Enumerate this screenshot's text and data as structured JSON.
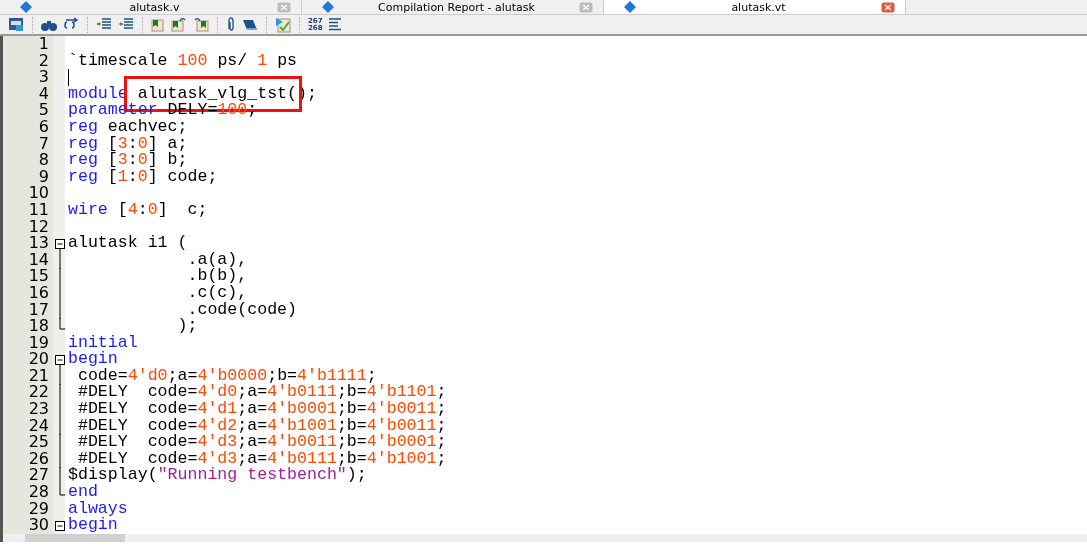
{
  "tabs": [
    {
      "label": "alutask.v",
      "selected": false
    },
    {
      "label": "Compilation Report - alutask",
      "selected": false
    },
    {
      "label": "alutask.vt",
      "selected": true
    }
  ],
  "toolbar": {
    "line_number_icon": [
      "267",
      "268"
    ]
  },
  "lines": [
    {
      "number": "1"
    },
    {
      "number": "2",
      "tokens": [
        {
          "kind": "plain",
          "text": "`timescale "
        },
        {
          "kind": "num",
          "text": "100"
        },
        {
          "kind": "plain",
          "text": " ps/ "
        },
        {
          "kind": "num",
          "text": "1"
        },
        {
          "kind": "plain",
          "text": " ps"
        }
      ]
    },
    {
      "number": "3",
      "cursor": true
    },
    {
      "number": "4",
      "tokens": [
        {
          "kind": "kw",
          "text": "module"
        },
        {
          "kind": "plain",
          "text": " alutask_vlg_tst(",
          "boxed": true
        },
        {
          "kind": "plain",
          "text": ");"
        }
      ]
    },
    {
      "number": "5",
      "tokens": [
        {
          "kind": "kw",
          "text": "parameter"
        },
        {
          "kind": "plain",
          "text": " DELY="
        },
        {
          "kind": "num",
          "text": "100"
        },
        {
          "kind": "plain",
          "text": ";"
        }
      ]
    },
    {
      "number": "6",
      "tokens": [
        {
          "kind": "kw",
          "text": "reg"
        },
        {
          "kind": "plain",
          "text": " eachvec;"
        }
      ]
    },
    {
      "number": "7",
      "tokens": [
        {
          "kind": "kw",
          "text": "reg"
        },
        {
          "kind": "plain",
          "text": " ["
        },
        {
          "kind": "num",
          "text": "3"
        },
        {
          "kind": "plain",
          "text": ":"
        },
        {
          "kind": "num",
          "text": "0"
        },
        {
          "kind": "plain",
          "text": "] a;"
        }
      ]
    },
    {
      "number": "8",
      "tokens": [
        {
          "kind": "kw",
          "text": "reg"
        },
        {
          "kind": "plain",
          "text": " ["
        },
        {
          "kind": "num",
          "text": "3"
        },
        {
          "kind": "plain",
          "text": ":"
        },
        {
          "kind": "num",
          "text": "0"
        },
        {
          "kind": "plain",
          "text": "] b;"
        }
      ]
    },
    {
      "number": "9",
      "tokens": [
        {
          "kind": "kw",
          "text": "reg"
        },
        {
          "kind": "plain",
          "text": " ["
        },
        {
          "kind": "num",
          "text": "1"
        },
        {
          "kind": "plain",
          "text": ":"
        },
        {
          "kind": "num",
          "text": "0"
        },
        {
          "kind": "plain",
          "text": "] code;"
        }
      ]
    },
    {
      "number": "10"
    },
    {
      "number": "11",
      "tokens": [
        {
          "kind": "kw",
          "text": "wire"
        },
        {
          "kind": "plain",
          "text": " ["
        },
        {
          "kind": "num",
          "text": "4"
        },
        {
          "kind": "plain",
          "text": ":"
        },
        {
          "kind": "num",
          "text": "0"
        },
        {
          "kind": "plain",
          "text": "]  c;"
        }
      ]
    },
    {
      "number": "12"
    },
    {
      "number": "13",
      "fold_open": true,
      "tokens": [
        {
          "kind": "plain",
          "text": "alutask i1 ("
        }
      ]
    },
    {
      "number": "14",
      "in_fold": true,
      "tokens": [
        {
          "kind": "plain",
          "text": "            .a(a),"
        }
      ]
    },
    {
      "number": "15",
      "in_fold": true,
      "tokens": [
        {
          "kind": "plain",
          "text": "            .b(b),"
        }
      ]
    },
    {
      "number": "16",
      "in_fold": true,
      "tokens": [
        {
          "kind": "plain",
          "text": "            .c(c),"
        }
      ]
    },
    {
      "number": "17",
      "in_fold": true,
      "tokens": [
        {
          "kind": "plain",
          "text": "            .code(code)"
        }
      ]
    },
    {
      "number": "18",
      "fold_end": true,
      "tokens": [
        {
          "kind": "plain",
          "text": "           );"
        }
      ]
    },
    {
      "number": "19",
      "tokens": [
        {
          "kind": "kw",
          "text": "initial"
        }
      ]
    },
    {
      "number": "20",
      "fold_open": true,
      "tokens": [
        {
          "kind": "kw",
          "text": "begin"
        }
      ]
    },
    {
      "number": "21",
      "in_fold": true,
      "tokens": [
        {
          "kind": "plain",
          "text": " code="
        },
        {
          "kind": "num",
          "text": "4'd0"
        },
        {
          "kind": "plain",
          "text": ";a="
        },
        {
          "kind": "num",
          "text": "4'b0000"
        },
        {
          "kind": "plain",
          "text": ";b="
        },
        {
          "kind": "num",
          "text": "4'b1111"
        },
        {
          "kind": "plain",
          "text": ";"
        }
      ]
    },
    {
      "number": "22",
      "in_fold": true,
      "tokens": [
        {
          "kind": "plain",
          "text": " #DELY  code="
        },
        {
          "kind": "num",
          "text": "4'd0"
        },
        {
          "kind": "plain",
          "text": ";a="
        },
        {
          "kind": "num",
          "text": "4'b0111"
        },
        {
          "kind": "plain",
          "text": ";b="
        },
        {
          "kind": "num",
          "text": "4'b1101"
        },
        {
          "kind": "plain",
          "text": ";"
        }
      ]
    },
    {
      "number": "23",
      "in_fold": true,
      "tokens": [
        {
          "kind": "plain",
          "text": " #DELY  code="
        },
        {
          "kind": "num",
          "text": "4'd1"
        },
        {
          "kind": "plain",
          "text": ";a="
        },
        {
          "kind": "num",
          "text": "4'b0001"
        },
        {
          "kind": "plain",
          "text": ";b="
        },
        {
          "kind": "num",
          "text": "4'b0011"
        },
        {
          "kind": "plain",
          "text": ";"
        }
      ]
    },
    {
      "number": "24",
      "in_fold": true,
      "tokens": [
        {
          "kind": "plain",
          "text": " #DELY  code="
        },
        {
          "kind": "num",
          "text": "4'd2"
        },
        {
          "kind": "plain",
          "text": ";a="
        },
        {
          "kind": "num",
          "text": "4'b1001"
        },
        {
          "kind": "plain",
          "text": ";b="
        },
        {
          "kind": "num",
          "text": "4'b0011"
        },
        {
          "kind": "plain",
          "text": ";"
        }
      ]
    },
    {
      "number": "25",
      "in_fold": true,
      "tokens": [
        {
          "kind": "plain",
          "text": " #DELY  code="
        },
        {
          "kind": "num",
          "text": "4'd3"
        },
        {
          "kind": "plain",
          "text": ";a="
        },
        {
          "kind": "num",
          "text": "4'b0011"
        },
        {
          "kind": "plain",
          "text": ";b="
        },
        {
          "kind": "num",
          "text": "4'b0001"
        },
        {
          "kind": "plain",
          "text": ";"
        }
      ]
    },
    {
      "number": "26",
      "in_fold": true,
      "tokens": [
        {
          "kind": "plain",
          "text": " #DELY  code="
        },
        {
          "kind": "num",
          "text": "4'd3"
        },
        {
          "kind": "plain",
          "text": ";a="
        },
        {
          "kind": "num",
          "text": "4'b0111"
        },
        {
          "kind": "plain",
          "text": ";b="
        },
        {
          "kind": "num",
          "text": "4'b1001"
        },
        {
          "kind": "plain",
          "text": ";"
        }
      ]
    },
    {
      "number": "27",
      "in_fold": true,
      "tokens": [
        {
          "kind": "plain",
          "text": "$display("
        },
        {
          "kind": "str",
          "text": "\"Running testbench\""
        },
        {
          "kind": "plain",
          "text": ");"
        }
      ]
    },
    {
      "number": "28",
      "fold_end": true,
      "tokens": [
        {
          "kind": "kw",
          "text": "end"
        }
      ]
    },
    {
      "number": "29",
      "tokens": [
        {
          "kind": "kw",
          "text": "always"
        }
      ]
    },
    {
      "number": "30",
      "fold_open": true,
      "tokens": [
        {
          "kind": "kw",
          "text": "begin"
        }
      ]
    }
  ]
}
